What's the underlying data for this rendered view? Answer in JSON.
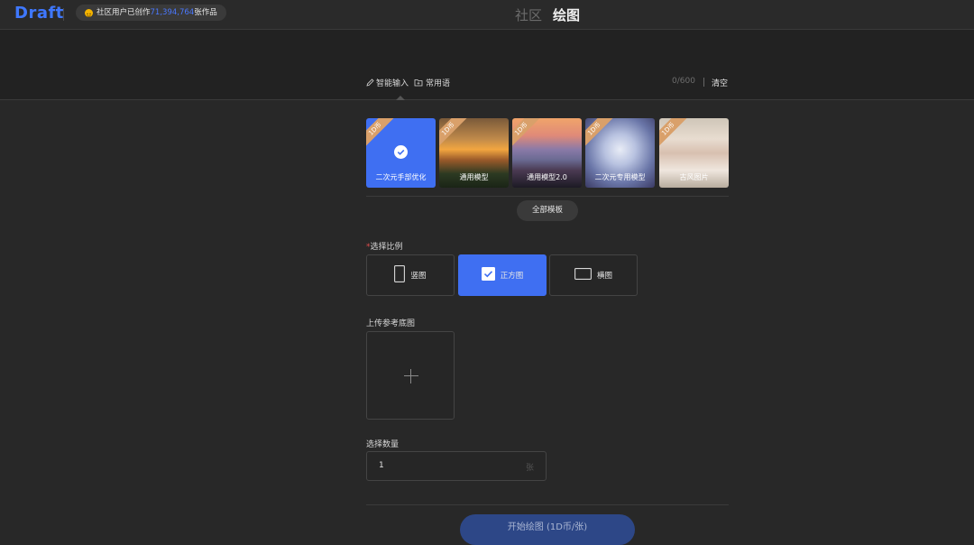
{
  "header": {
    "logo": "Draft",
    "stats": {
      "prefix": "社区用户已创作",
      "count": "71,394,764",
      "suffix": "张作品"
    },
    "nav": {
      "community": "社区",
      "draw": "绘图"
    }
  },
  "prompt": {
    "smart_input": "智能输入",
    "phrases": "常用语",
    "counter": "0/600",
    "clear": "清空"
  },
  "models": [
    {
      "badge": "1D币",
      "label": "二次元手部优化",
      "selected": true
    },
    {
      "badge": "1D币",
      "label": "通用模型",
      "selected": false
    },
    {
      "badge": "1D币",
      "label": "通用模型2.0",
      "selected": false
    },
    {
      "badge": "1D币",
      "label": "二次元专用模型",
      "selected": false
    },
    {
      "badge": "1D币",
      "label": "古风图片",
      "selected": false
    }
  ],
  "all_templates": "全部模板",
  "ratio": {
    "required_mark": "*",
    "label": "选择比例",
    "options": [
      "竖图",
      "正方图",
      "横图"
    ],
    "selected": "正方图"
  },
  "upload": {
    "label": "上传参考底图"
  },
  "quantity": {
    "label": "选择数量",
    "value": "1",
    "unit": "张"
  },
  "start_button": "开始绘图 (1D币/张)",
  "colors": {
    "accent": "#3f6ff2",
    "required": "#e04c4c",
    "badge": "#d9a06a"
  }
}
